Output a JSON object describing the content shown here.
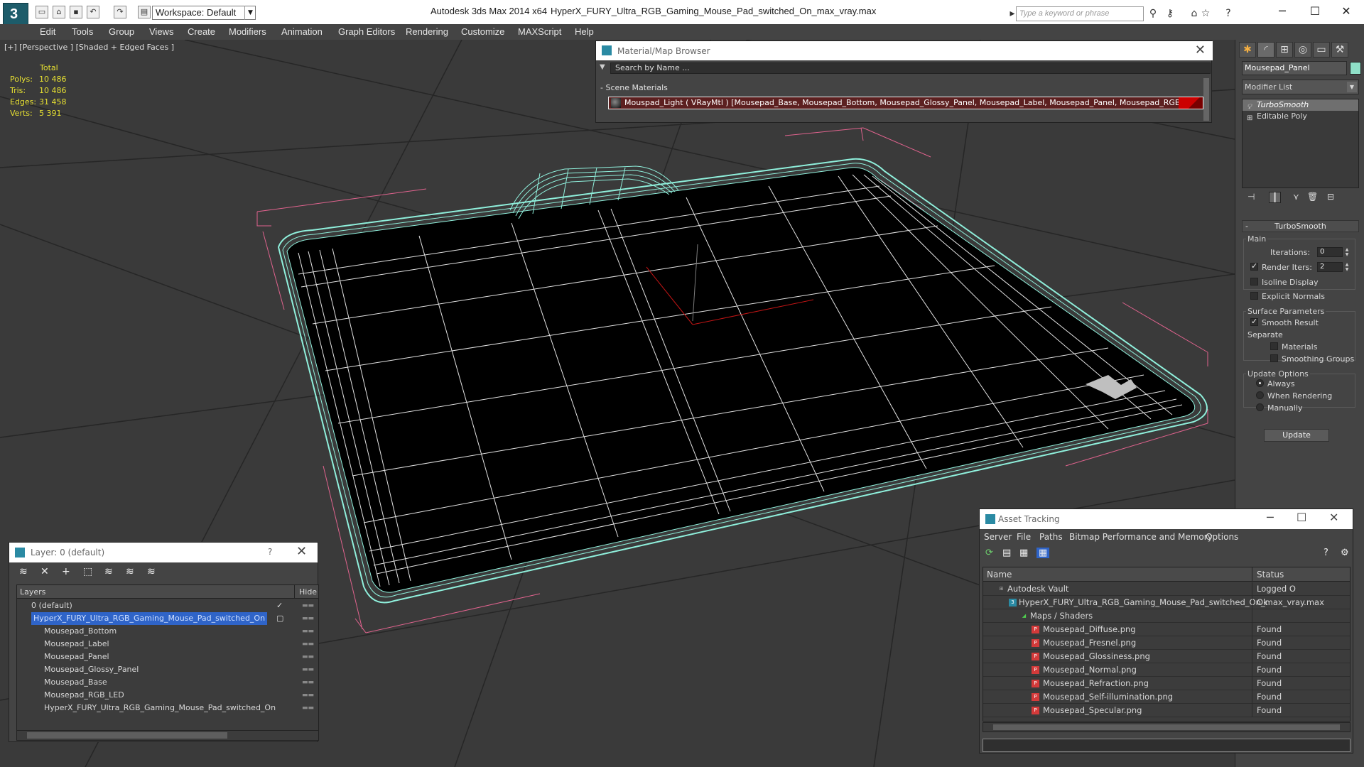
{
  "titlebar": {
    "workspace": "Workspace: Default",
    "app_title": "Autodesk 3ds Max  2014 x64",
    "file_title": "HyperX_FURY_Ultra_RGB_Gaming_Mouse_Pad_switched_On_max_vray.max",
    "search_placeholder": "Type a keyword or phrase"
  },
  "menu": [
    "Edit",
    "Tools",
    "Group",
    "Views",
    "Create",
    "Modifiers",
    "Animation",
    "Graph Editors",
    "Rendering",
    "Customize",
    "MAXScript",
    "Help"
  ],
  "viewport": {
    "label": "[+] [Perspective ] [Shaded + Edged Faces ]",
    "stats_header": "Total",
    "stats": [
      {
        "k": "Polys:",
        "v": "10 486"
      },
      {
        "k": "Tris:",
        "v": "10 486"
      },
      {
        "k": "Edges:",
        "v": "31 458"
      },
      {
        "k": "Verts:",
        "v": "5 391"
      }
    ]
  },
  "material_browser": {
    "title": "Material/Map Browser",
    "search": "Search by Name ...",
    "section": "- Scene Materials",
    "row": "Mouspad_Light ( VRayMtl ) [Mousepad_Base, Mousepad_Bottom, Mousepad_Glossy_Panel, Mousepad_Label, Mousepad_Panel, Mousepad_RGB_LED]"
  },
  "command_panel": {
    "object_name": "Mousepad_Panel",
    "modifier_list": "Modifier List",
    "stack": [
      "TurboSmooth",
      "Editable Poly"
    ],
    "turbosmooth": {
      "title": "TurboSmooth",
      "main": "Main",
      "iterations_label": "Iterations:",
      "iterations": "0",
      "render_iters_label": "Render Iters:",
      "render_iters": "2",
      "isoline": "Isoline Display",
      "explicit": "Explicit Normals",
      "surface": "Surface Parameters",
      "smooth_result": "Smooth Result",
      "separate": "Separate",
      "materials": "Materials",
      "smoothing_groups": "Smoothing Groups",
      "update_options": "Update Options",
      "always": "Always",
      "when_rendering": "When Rendering",
      "manually": "Manually",
      "update": "Update"
    }
  },
  "layer_dialog": {
    "title": "Layer: 0 (default)",
    "help": "?",
    "col_layers": "Layers",
    "col_hide": "Hide",
    "rows": [
      {
        "name": "0 (default)",
        "level": 1
      },
      {
        "name": "HyperX_FURY_Ultra_RGB_Gaming_Mouse_Pad_switched_On",
        "level": 1
      },
      {
        "name": "Mousepad_Bottom",
        "level": 2
      },
      {
        "name": "Mousepad_Label",
        "level": 2
      },
      {
        "name": "Mousepad_Panel",
        "level": 2
      },
      {
        "name": "Mousepad_Glossy_Panel",
        "level": 2
      },
      {
        "name": "Mousepad_Base",
        "level": 2
      },
      {
        "name": "Mousepad_RGB_LED",
        "level": 2
      },
      {
        "name": "HyperX_FURY_Ultra_RGB_Gaming_Mouse_Pad_switched_On",
        "level": 2
      }
    ]
  },
  "asset_tracking": {
    "title": "Asset Tracking",
    "menu": [
      "Server",
      "File",
      "Paths",
      "Bitmap Performance and Memory",
      "Options"
    ],
    "col_name": "Name",
    "col_status": "Status",
    "rows": [
      {
        "name": "Autodesk Vault",
        "status": "Logged O",
        "level": 0
      },
      {
        "name": "HyperX_FURY_Ultra_RGB_Gaming_Mouse_Pad_switched_On_max_vray.max",
        "status": "Ok",
        "level": 1
      },
      {
        "name": "Maps / Shaders",
        "status": "",
        "level": 2
      },
      {
        "name": "Mousepad_Diffuse.png",
        "status": "Found",
        "level": 3
      },
      {
        "name": "Mousepad_Fresnel.png",
        "status": "Found",
        "level": 3
      },
      {
        "name": "Mousepad_Glossiness.png",
        "status": "Found",
        "level": 3
      },
      {
        "name": "Mousepad_Normal.png",
        "status": "Found",
        "level": 3
      },
      {
        "name": "Mousepad_Refraction.png",
        "status": "Found",
        "level": 3
      },
      {
        "name": "Mousepad_Self-illumination.png",
        "status": "Found",
        "level": 3
      },
      {
        "name": "Mousepad_Specular.png",
        "status": "Found",
        "level": 3
      }
    ]
  }
}
